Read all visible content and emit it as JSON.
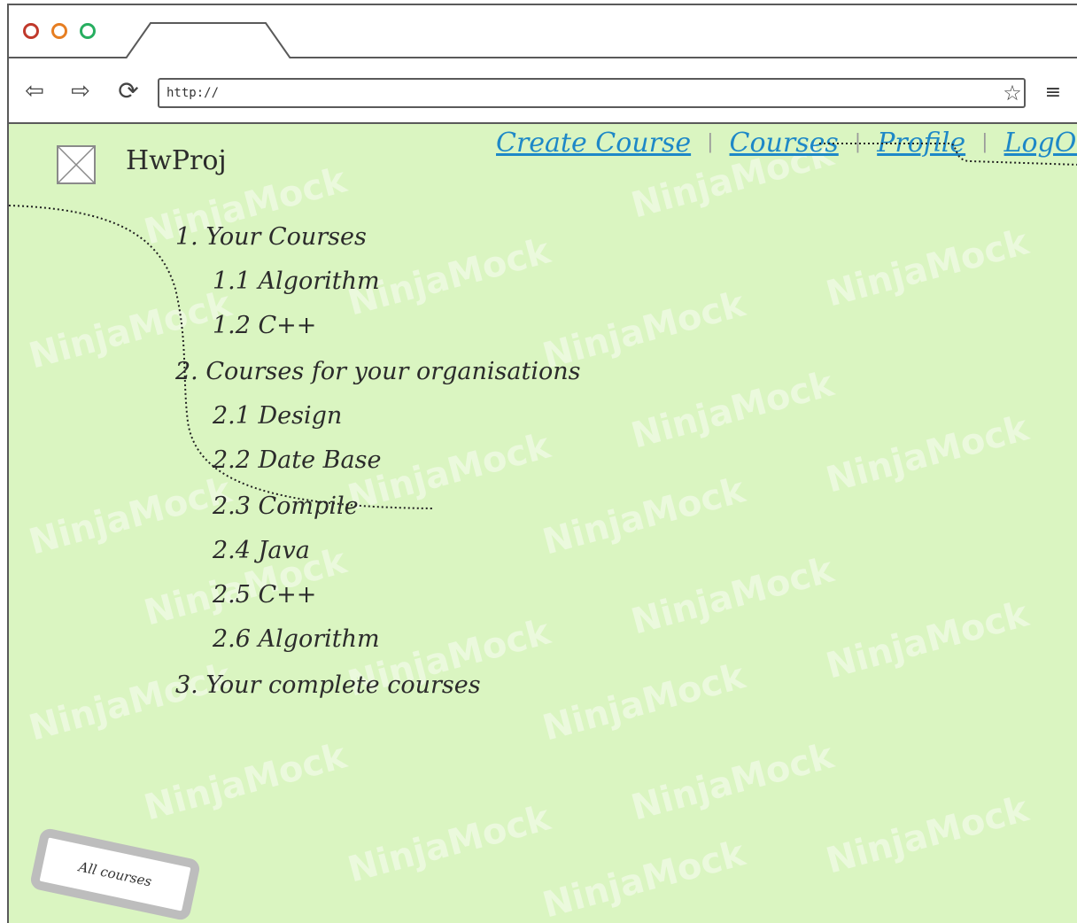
{
  "browser": {
    "url": "http://"
  },
  "header": {
    "app_title": "HwProj",
    "nav": [
      "Create Course",
      "Courses",
      "Profile",
      "LogOut"
    ]
  },
  "outline": [
    "1. Your Courses",
    "1.1 Algorithm",
    "1.2 C++",
    "2. Courses for your organisations",
    "2.1 Design",
    "2.2 Date Base",
    "2.3 Compile",
    "2.4 Java",
    "2.5 C++",
    "2.6 Algorithm",
    "3. Your complete courses"
  ],
  "all_courses_button": "All courses",
  "watermark": "NinjaMock",
  "colors": {
    "page_bg": "#daf5c1",
    "link": "#1e88c7"
  }
}
